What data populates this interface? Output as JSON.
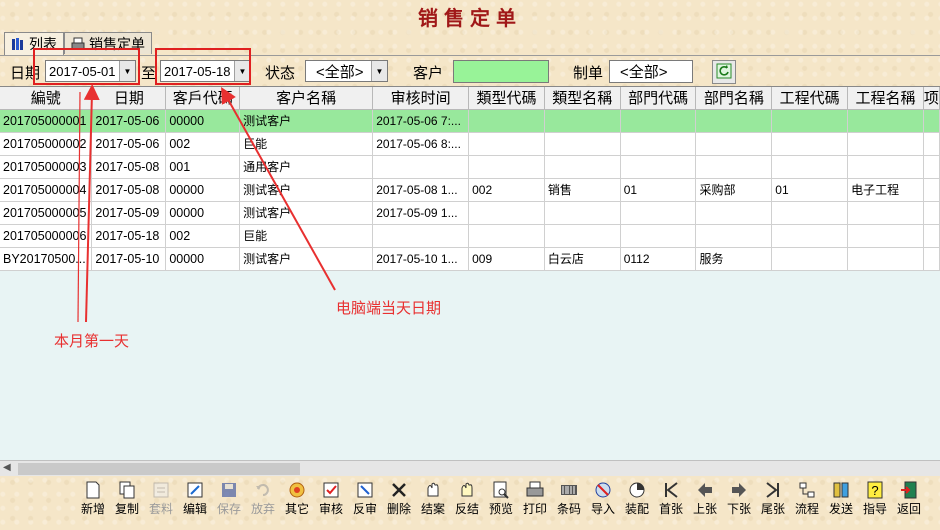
{
  "window": {
    "title": "销售定单"
  },
  "tabs": [
    {
      "label": "列表",
      "icon": "books-icon"
    },
    {
      "label": "销售定单",
      "icon": "printer-icon"
    }
  ],
  "filter": {
    "date_label": "日期",
    "date_from": "2017-05-01",
    "to_label": "至",
    "date_to": "2017-05-18",
    "status_label": "状态",
    "status_value": "<全部>",
    "customer_label": "客户",
    "customer_value": "",
    "maker_label": "制单",
    "maker_value": "<全部>",
    "refresh_icon": "refresh-icon",
    "accent_color": "#98f398"
  },
  "grid": {
    "columns": [
      "編號",
      "日期",
      "客戶代碼",
      "客户名稱",
      "审核时间",
      "類型代碼",
      "類型名稱",
      "部門代碼",
      "部門名稱",
      "工程代碼",
      "工程名稱",
      "项"
    ],
    "rows": [
      [
        "201705000001",
        "2017-05-06",
        "00000",
        "测试客户",
        "2017-05-06 7:...",
        "",
        "",
        "",
        "",
        "",
        "",
        ""
      ],
      [
        "201705000002",
        "2017-05-06",
        "002",
        "巨能",
        "2017-05-06 8:...",
        "",
        "",
        "",
        "",
        "",
        "",
        ""
      ],
      [
        "201705000003",
        "2017-05-08",
        "001",
        "通用客户",
        "",
        "",
        "",
        "",
        "",
        "",
        "",
        ""
      ],
      [
        "201705000004",
        "2017-05-08",
        "00000",
        "测试客户",
        "2017-05-08 1...",
        "002",
        "销售",
        "01",
        "采购部",
        "01",
        "电子工程",
        ""
      ],
      [
        "201705000005",
        "2017-05-09",
        "00000",
        "测试客户",
        "2017-05-09 1...",
        "",
        "",
        "",
        "",
        "",
        "",
        ""
      ],
      [
        "201705000006",
        "2017-05-18",
        "002",
        "巨能",
        "",
        "",
        "",
        "",
        "",
        "",
        "",
        ""
      ],
      [
        "BY20170500...",
        "2017-05-10",
        "00000",
        "测试客户",
        "2017-05-10 1...",
        "009",
        "白云店",
        "0112",
        "服务",
        "",
        "",
        ""
      ]
    ],
    "selected_row": 0,
    "selected_color": "#98e89c"
  },
  "annotations": {
    "first_day": "本月第一天",
    "today": "电脑端当天日期",
    "color": "#e83030"
  },
  "buttons": [
    {
      "label": "新增",
      "icon": "new-document-icon",
      "enabled": true
    },
    {
      "label": "复制",
      "icon": "copy-icon",
      "enabled": true
    },
    {
      "label": "套料",
      "icon": "bom-icon",
      "enabled": false
    },
    {
      "label": "编辑",
      "icon": "edit-icon",
      "enabled": true
    },
    {
      "label": "保存",
      "icon": "save-icon",
      "enabled": false
    },
    {
      "label": "放弃",
      "icon": "undo-icon",
      "enabled": false
    },
    {
      "label": "其它",
      "icon": "other-icon",
      "enabled": true
    },
    {
      "label": "审核",
      "icon": "audit-icon",
      "enabled": true
    },
    {
      "label": "反审",
      "icon": "unaudit-icon",
      "enabled": true
    },
    {
      "label": "删除",
      "icon": "delete-icon",
      "enabled": true
    },
    {
      "label": "结案",
      "icon": "close-case-icon",
      "enabled": true
    },
    {
      "label": "反结",
      "icon": "reopen-icon",
      "enabled": true
    },
    {
      "label": "预览",
      "icon": "preview-icon",
      "enabled": true
    },
    {
      "label": "打印",
      "icon": "print-icon",
      "enabled": true
    },
    {
      "label": "条码",
      "icon": "barcode-icon",
      "enabled": true
    },
    {
      "label": "导入",
      "icon": "import-icon",
      "enabled": true
    },
    {
      "label": "装配",
      "icon": "assemble-icon",
      "enabled": true
    },
    {
      "label": "首张",
      "icon": "first-icon",
      "enabled": true
    },
    {
      "label": "上张",
      "icon": "previous-icon",
      "enabled": true
    },
    {
      "label": "下张",
      "icon": "next-icon",
      "enabled": true
    },
    {
      "label": "尾张",
      "icon": "last-icon",
      "enabled": true
    },
    {
      "label": "流程",
      "icon": "flow-icon",
      "enabled": true
    },
    {
      "label": "发送",
      "icon": "send-icon",
      "enabled": true
    },
    {
      "label": "指导",
      "icon": "help-icon",
      "enabled": true
    },
    {
      "label": "返回",
      "icon": "exit-icon",
      "enabled": true
    }
  ]
}
